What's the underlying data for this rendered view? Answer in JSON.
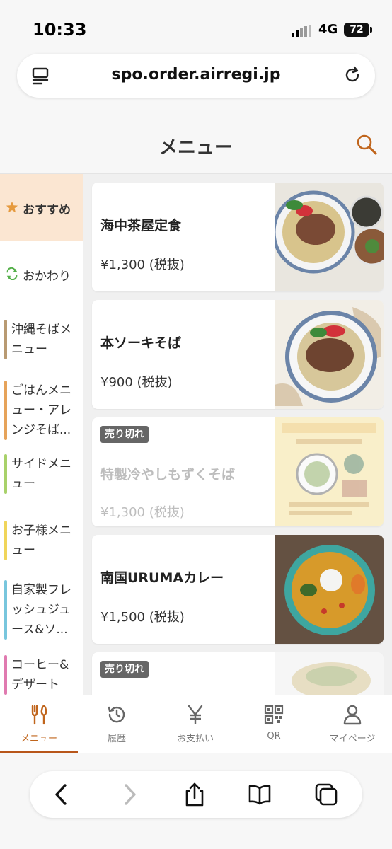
{
  "status": {
    "time": "10:33",
    "network": "4G",
    "battery": "72"
  },
  "browser": {
    "url": "spo.order.airregi.jp"
  },
  "header": {
    "title": "メニュー"
  },
  "sidebar": {
    "recommended": "おすすめ",
    "refill": "おかわり",
    "categories": [
      {
        "label": "沖縄そばメニュー",
        "color": "#b89a72"
      },
      {
        "label": "ごはんメニュー・アレンジそば...",
        "color": "#e6a35a"
      },
      {
        "label": "サイドメニュー",
        "color": "#a8d16a"
      },
      {
        "label": "お子様メニュー",
        "color": "#f0d55a"
      },
      {
        "label": "自家製フレッシュジュース&ソ...",
        "color": "#78c6dd"
      },
      {
        "label": "コーヒー&デザート",
        "color": "#e07ab0"
      }
    ]
  },
  "menu": [
    {
      "name": "海中茶屋定食",
      "price": "¥1,300 (税抜)",
      "soldout": false
    },
    {
      "name": "本ソーキそば",
      "price": "¥900 (税抜)",
      "soldout": false
    },
    {
      "name": "特製冷やしもずくそば",
      "price": "¥1,300 (税抜)",
      "soldout": true,
      "badge": "売り切れ"
    },
    {
      "name": "南国URUMAカレー",
      "price": "¥1,500 (税抜)",
      "soldout": false
    },
    {
      "name": "",
      "price": "",
      "soldout": true,
      "badge": "売り切れ"
    }
  ],
  "tabs": [
    {
      "label": "メニュー",
      "icon": "utensils-icon",
      "active": true
    },
    {
      "label": "履歴",
      "icon": "history-icon",
      "active": false
    },
    {
      "label": "お支払い",
      "icon": "yen-icon",
      "active": false
    },
    {
      "label": "QR",
      "icon": "qr-icon",
      "active": false
    },
    {
      "label": "マイページ",
      "icon": "person-icon",
      "active": false
    }
  ],
  "colors": {
    "accent": "#b8561a",
    "recommended_bg": "#fbe6d2",
    "soldout_badge": "#666666"
  }
}
